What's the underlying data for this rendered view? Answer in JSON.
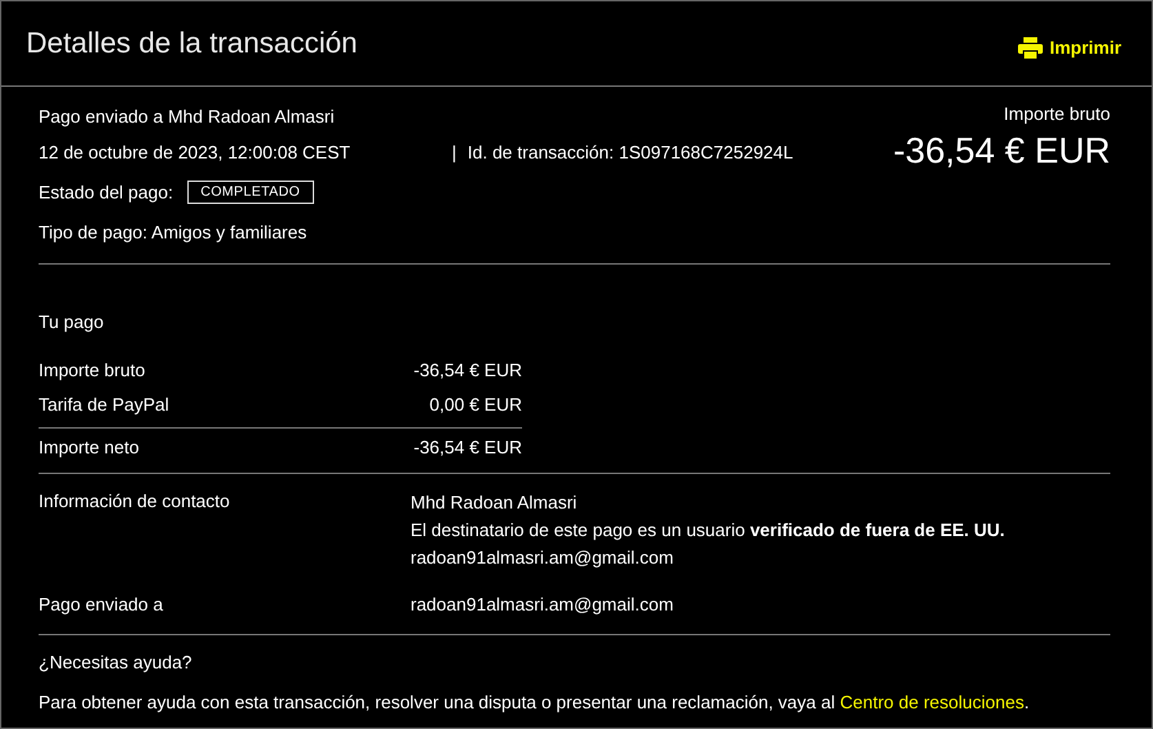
{
  "header": {
    "title": "Detalles de la transacción",
    "print_button": "Imprimir"
  },
  "summary": {
    "recipient": "Pago enviado a Mhd Radoan Almasri",
    "date": "12 de octubre de 2023, 12:00:08 CEST",
    "separator": "|",
    "transaction_id": "Id. de transacción: 1S097168C7252924L",
    "status_label": "Estado del pago:",
    "status": "COMPLETADO",
    "payment_type": "Tipo de pago: Amigos y familiares",
    "gross_label": "Importe bruto",
    "gross_amount": "-36,54 € EUR"
  },
  "payment": {
    "title": "Tu pago",
    "rows": [
      {
        "label": "Importe bruto",
        "value": "-36,54 € EUR"
      },
      {
        "label": "Tarifa de PayPal",
        "value": "0,00 € EUR"
      }
    ],
    "total": {
      "label": "Importe neto",
      "value": "-36,54 € EUR"
    }
  },
  "contact": {
    "label": "Información de contacto",
    "name": "Mhd Radoan Almasri",
    "note": "El destinatario de este pago es un usuario **verificado de fuera de EE. UU.**",
    "email": "radoan91almasri.am@gmail.com"
  },
  "sent_to": {
    "label": "Pago enviado a",
    "email": "radoan91almasri.am@gmail.com"
  },
  "help": {
    "title": "¿Necesitas ayuda?",
    "text": "Para obtener ayuda con esta transacción, resolver una disputa o presentar una reclamación, vaya al",
    "link": "Centro de resoluciones",
    "end": "."
  }
}
